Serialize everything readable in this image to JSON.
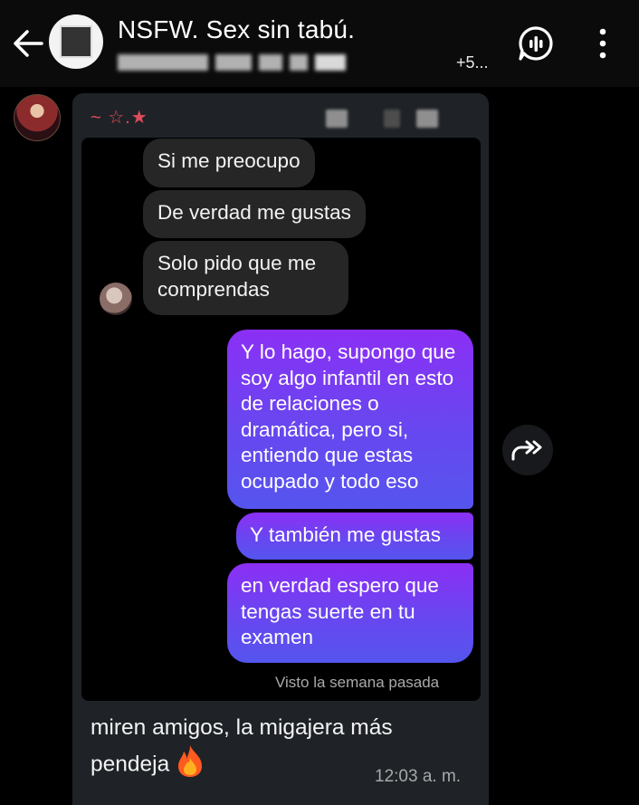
{
  "header": {
    "title": "NSFW. Sex sin tabú.",
    "members_more": "+5..."
  },
  "message": {
    "sender_name": "~ ☆.★",
    "screenshot": {
      "incoming": [
        "Si me preocupo",
        "De verdad me gustas",
        "Solo pido que me comprendas"
      ],
      "outgoing": [
        "Y lo hago, supongo que soy algo infantil en esto de relaciones o dramática, pero si, entiendo que estas ocupado y todo eso",
        "Y también me gustas",
        "en verdad espero que tengas suerte en tu examen"
      ],
      "seen_text": "Visto la semana pasada"
    },
    "caption": "miren amigos, la migajera más pendeja",
    "time": "12:03 a. m."
  },
  "icons": {
    "back": "arrow-left-icon",
    "voice": "voice-chat-icon",
    "menu": "more-vert-icon",
    "forward": "share-forward-icon",
    "fire": "fire-emoji-icon"
  },
  "colors": {
    "outgoing_gradient_top": "#8c2ff5",
    "outgoing_gradient_bottom": "#5555ee",
    "sender_name": "#e04b59",
    "bubble_bg": "#1f2327"
  }
}
